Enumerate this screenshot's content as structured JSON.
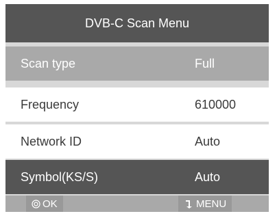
{
  "menu": {
    "title": "DVB-C Scan Menu",
    "rows": [
      {
        "label": "Scan type",
        "value": "Full"
      },
      {
        "label": "Frequency",
        "value": "610000"
      },
      {
        "label": "Network ID",
        "value": "Auto"
      },
      {
        "label": "Symbol(KS/S)",
        "value": "Auto"
      }
    ]
  },
  "footer": {
    "ok_label": "OK",
    "ok_icon": "ok-circle-icon",
    "menu_label": "MENU",
    "menu_icon": "return-arrow-icon"
  },
  "colors": {
    "title_bg": "#555555",
    "highlight_bg": "#a9a9a9",
    "row_bg": "#ffffff",
    "dark_row_bg": "#555555",
    "footer_bg": "#a9a9a9"
  }
}
